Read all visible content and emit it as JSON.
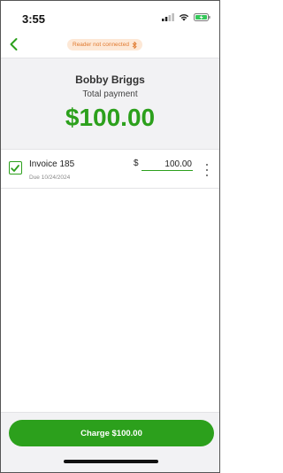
{
  "status_bar": {
    "time": "3:55"
  },
  "header": {
    "reader_status": "Reader not connected"
  },
  "summary": {
    "customer_name": "Bobby Briggs",
    "total_label": "Total payment",
    "total_amount": "$100.00"
  },
  "invoices": [
    {
      "title": "Invoice 185",
      "due": "Due 10/24/2024",
      "currency": "$",
      "amount": "100.00",
      "checked": true
    }
  ],
  "actions": {
    "charge_label": "Charge $100.00"
  },
  "colors": {
    "brand_green": "#2ca01c",
    "warning_orange": "#e07a2f",
    "warning_bg": "#fde8d6",
    "panel_gray": "#f2f2f4"
  },
  "icons": {
    "back": "chevron-left-icon",
    "reader": "bluetooth-icon",
    "checkbox": "checkmark-icon",
    "more": "vertical-ellipsis-icon"
  }
}
